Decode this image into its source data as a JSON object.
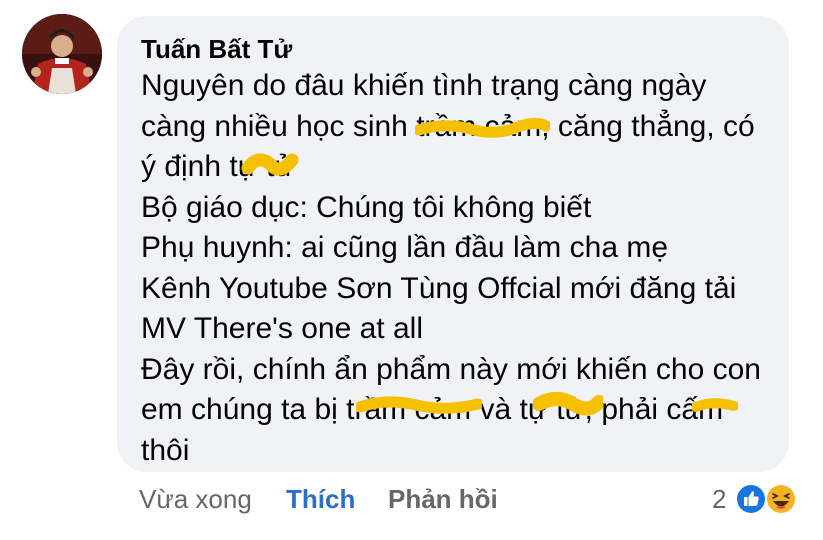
{
  "comment": {
    "author": "Tuấn Bất Tử",
    "lines": [
      "Nguyên do đâu khiến tình trạng càng ngày",
      "càng nhiều học sinh trầm cảm, căng thẳng, có",
      "ý định tự tử",
      "Bộ giáo dục: Chúng tôi không biết",
      "Phụ huynh: ai cũng lần đầu làm cha mẹ",
      "Kênh Youtube Sơn Tùng Offcial mới đăng tải",
      "MV There's one at all",
      "Đây rồi, chính ẩn phẩm này mới khiến cho con",
      "em chúng ta bị trầm cảm và tự tử, phải cấm",
      "thôi"
    ]
  },
  "actions": {
    "time": "Vừa xong",
    "like": "Thích",
    "reply": "Phản hồi"
  },
  "reactions": {
    "count": "2",
    "icons": [
      "like-icon",
      "haha-icon"
    ]
  },
  "colors": {
    "bubble": "#f0f2f5",
    "like_text": "#2d6ec6",
    "meta_text": "#65676b",
    "scribble": "#f5c000"
  }
}
